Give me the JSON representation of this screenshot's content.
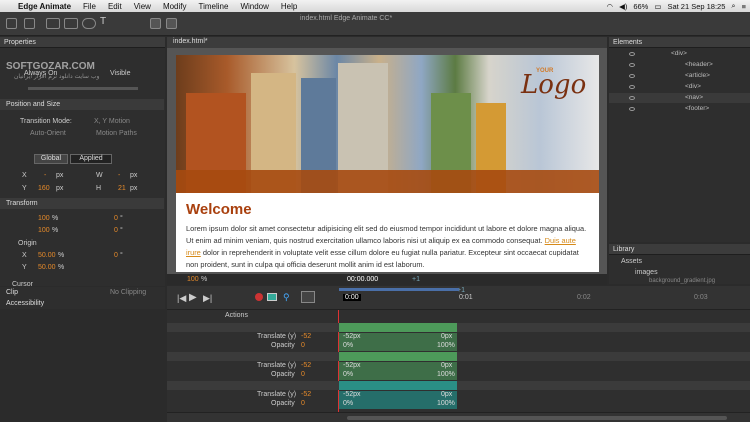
{
  "menubar": {
    "apple": "",
    "app": "Edge Animate",
    "items": [
      "File",
      "Edit",
      "View",
      "Modify",
      "Timeline",
      "Window",
      "Help"
    ],
    "battery": "66%",
    "clock": "Sat 21 Sep 18:25"
  },
  "toolbar": {
    "title": "index.html   Edge Animate CC*"
  },
  "watermark": {
    "line1": "SOFTGOZAR.COM",
    "line2": "وب سایت دانلود نرم افزار ایرانیان"
  },
  "properties": {
    "header": "Properties",
    "always_on": "Always On",
    "visible": "Visible",
    "position_size": "Position and Size",
    "transition_mode": "Transition Mode:",
    "xy_motion": "X, Y Motion",
    "auto_orient": "Auto-Orient",
    "motion_paths": "Motion Paths",
    "global": "Global",
    "applied": "Applied",
    "x_label": "X",
    "x_val": "-",
    "px1": "px",
    "w_label": "W",
    "w_val": "-",
    "px2": "px",
    "y_label": "Y",
    "y_val": "160",
    "px3": "px",
    "h_label": "H",
    "h_val": "21",
    "px4": "px",
    "transform": "Transform",
    "scale1": "100",
    "pct1": "%",
    "rot1": "0",
    "deg1": "°",
    "scale2": "100",
    "pct2": "%",
    "rot2": "0",
    "deg2": "°",
    "origin": "Origin",
    "ox": "X",
    "ox_val": "50.00",
    "oxp": "%",
    "oy": "Y",
    "oy_val": "50.00",
    "oyp": "%",
    "skew": "0",
    "skewd": "°",
    "cursor": "Cursor",
    "clip": "Clip",
    "clip_val": "No Clipping",
    "accessibility": "Accessibility"
  },
  "stage": {
    "tab": "index.html*",
    "zoom": "100",
    "zoom_pct": "%",
    "time": "00:00.000",
    "plus": "+1"
  },
  "page": {
    "logo_small": "YOUR",
    "logo": "Logo",
    "welcome": "Welcome",
    "para_before": "Lorem ipsum dolor sit amet consectetur adipisicing elit sed do eiusmod tempor incididunt ut labore et dolore magna aliqua. Ut enim ad minim veniam, quis nostrud exercitation ullamco laboris nisi ut aliquip ex ea commodo consequat. ",
    "link": "Duis aute irure",
    "para_after": " dolor in reprehenderit in voluptate velit esse cillum dolore eu fugiat nulla pariatur. Excepteur sint occaecat cupidatat non proident, sunt in culpa qui officia deserunt mollit anim id est laborum."
  },
  "elements": {
    "header": "Elements",
    "items": [
      "<div>",
      "<header>",
      "<article>",
      "<div>",
      "<nav>",
      "<footer>"
    ]
  },
  "library": {
    "header": "Library",
    "assets": "Assets",
    "images": "images",
    "file": "background_gradient.jpg"
  },
  "timeline": {
    "actions": "Actions",
    "t0": "0:00",
    "t1": "0:01",
    "t2": "0:02",
    "t3": "0:03",
    "plus": "+1",
    "rows": [
      {
        "translate": "Translate (y)",
        "tval": "-52",
        "opacity": "Opacity",
        "oval": "0",
        "s1": "-52px",
        "e1": "0px",
        "s2": "0%",
        "e2": "100%"
      },
      {
        "translate": "Translate (y)",
        "tval": "-52",
        "opacity": "Opacity",
        "oval": "0",
        "s1": "-52px",
        "e1": "0px",
        "s2": "0%",
        "e2": "100%"
      },
      {
        "translate": "Translate (y)",
        "tval": "-52",
        "opacity": "Opacity",
        "oval": "0",
        "s1": "-52px",
        "e1": "0px",
        "s2": "0%",
        "e2": "100%"
      }
    ]
  },
  "colors": {
    "accent": "#e58a2a",
    "welcome": "#a9400e",
    "link": "#d68a1a",
    "track_green": "#4d9a5a",
    "track_teal": "#2a8f86"
  }
}
